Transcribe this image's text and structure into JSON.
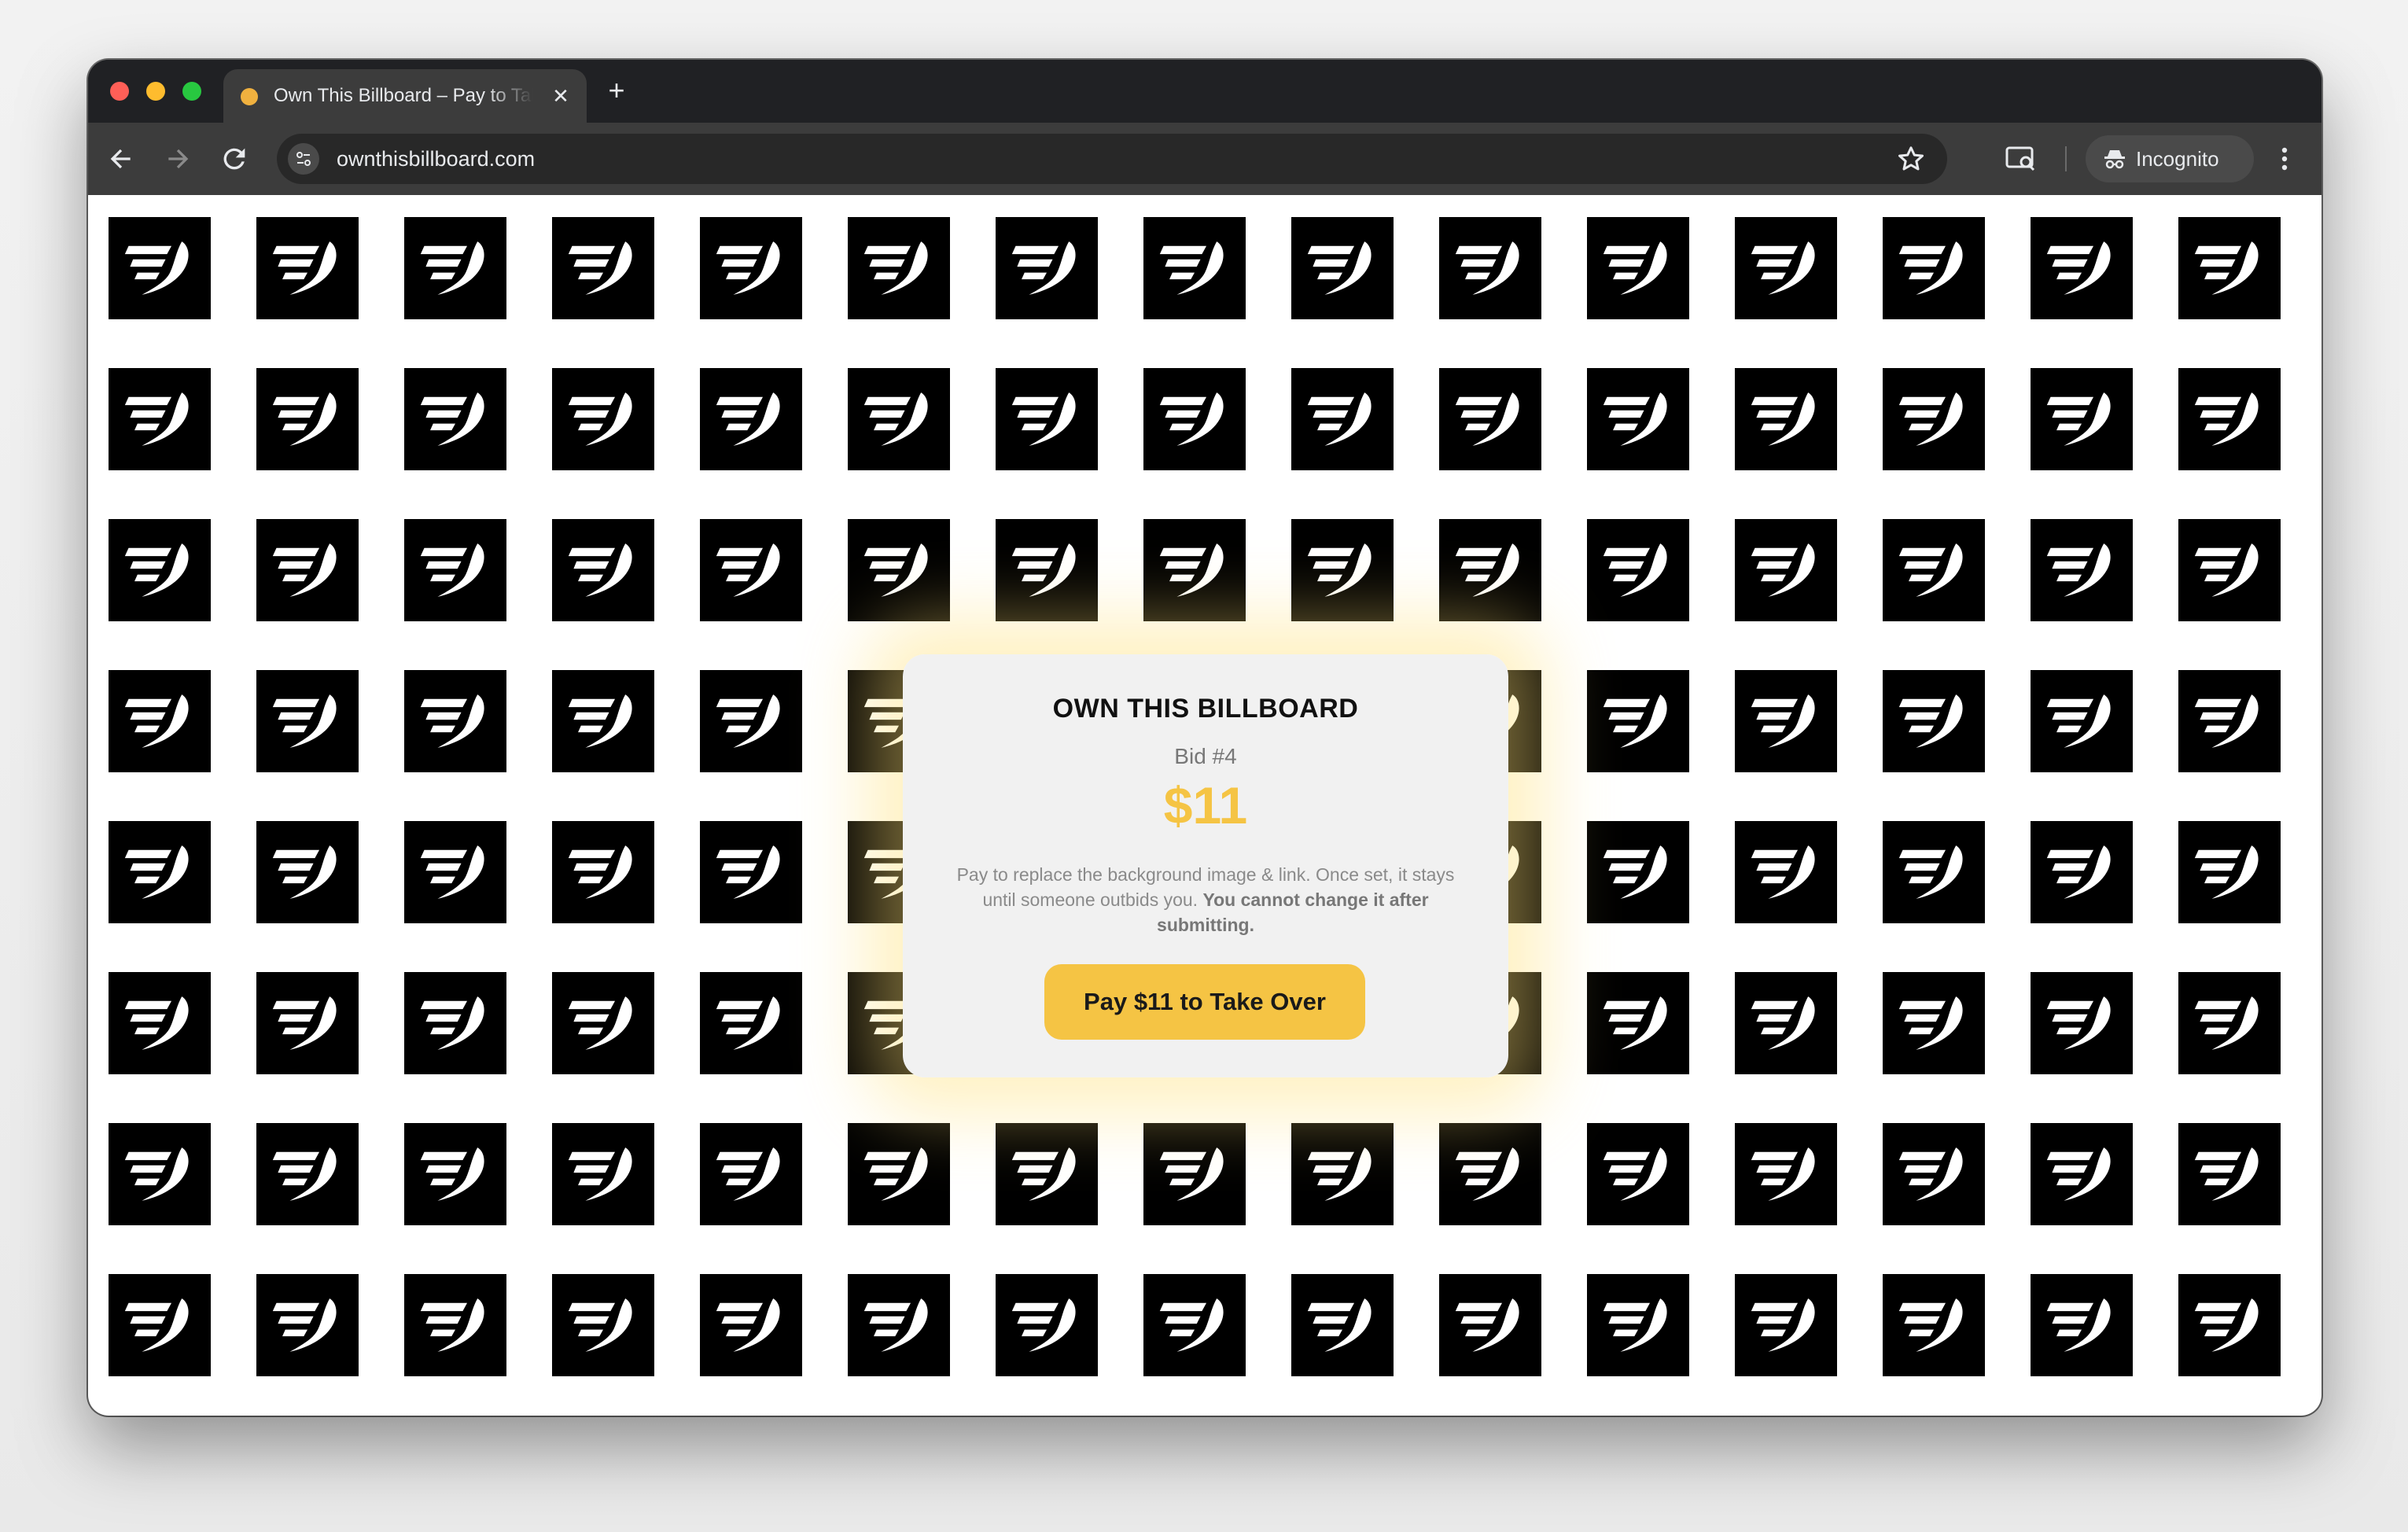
{
  "browser": {
    "tab_title": "Own This Billboard – Pay to Take Over",
    "tab_close": "✕",
    "new_tab": "+",
    "url": "ownthisbillboard.com",
    "profile_label": "Incognito",
    "icons": {
      "back": "arrow-left-icon",
      "forward": "arrow-right-icon",
      "reload": "reload-icon",
      "site_info": "tune-icon",
      "bookmark": "star-icon",
      "cast": "cast-search-icon",
      "incognito": "incognito-icon",
      "menu": "more-vert-icon"
    }
  },
  "billboard": {
    "tile_icon": "brand-bird-logo-icon",
    "tile_color": "#000000",
    "logo_color": "#ffffff"
  },
  "modal": {
    "title": "OWN THIS BILLBOARD",
    "bid": "Bid #4",
    "price": "$11",
    "description": "Pay to replace the background image & link. Once set, it stays until someone outbids you.",
    "description_bold": "You cannot change it after submitting.",
    "button_label": "Pay $11 to Take Over",
    "accent_color": "#f5c444"
  }
}
